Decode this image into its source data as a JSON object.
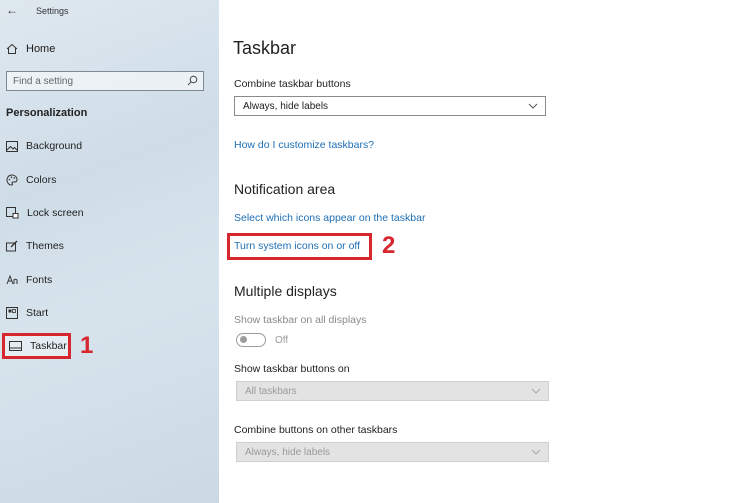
{
  "window": {
    "title": "Settings"
  },
  "sidebar": {
    "home_label": "Home",
    "search_placeholder": "Find a setting",
    "section_heading": "Personalization",
    "items": [
      {
        "label": "Background",
        "icon": "picture-icon"
      },
      {
        "label": "Colors",
        "icon": "palette-icon"
      },
      {
        "label": "Lock screen",
        "icon": "lock-screen-icon"
      },
      {
        "label": "Themes",
        "icon": "brush-icon"
      },
      {
        "label": "Fonts",
        "icon": "font-icon"
      },
      {
        "label": "Start",
        "icon": "start-icon"
      },
      {
        "label": "Taskbar",
        "icon": "taskbar-icon",
        "selected": true
      }
    ]
  },
  "main": {
    "title": "Taskbar",
    "combine_label": "Combine taskbar buttons",
    "combine_value": "Always, hide labels",
    "customize_link": "How do I customize taskbars?",
    "notification": {
      "heading": "Notification area",
      "select_icons_link": "Select which icons appear on the taskbar",
      "system_icons_link": "Turn system icons on or off"
    },
    "multiple_displays": {
      "heading": "Multiple displays",
      "show_all_label": "Show taskbar on all displays",
      "show_all_state": "Off",
      "show_buttons_label": "Show taskbar buttons on",
      "show_buttons_value": "All taskbars",
      "combine_other_label": "Combine buttons on other taskbars",
      "combine_other_value": "Always, hide labels"
    }
  },
  "annotations": {
    "step1": "1",
    "step2": "2",
    "color": "#d7262d"
  },
  "colors": {
    "accent_link": "#1f6fb5",
    "highlight": "#d7262d"
  }
}
